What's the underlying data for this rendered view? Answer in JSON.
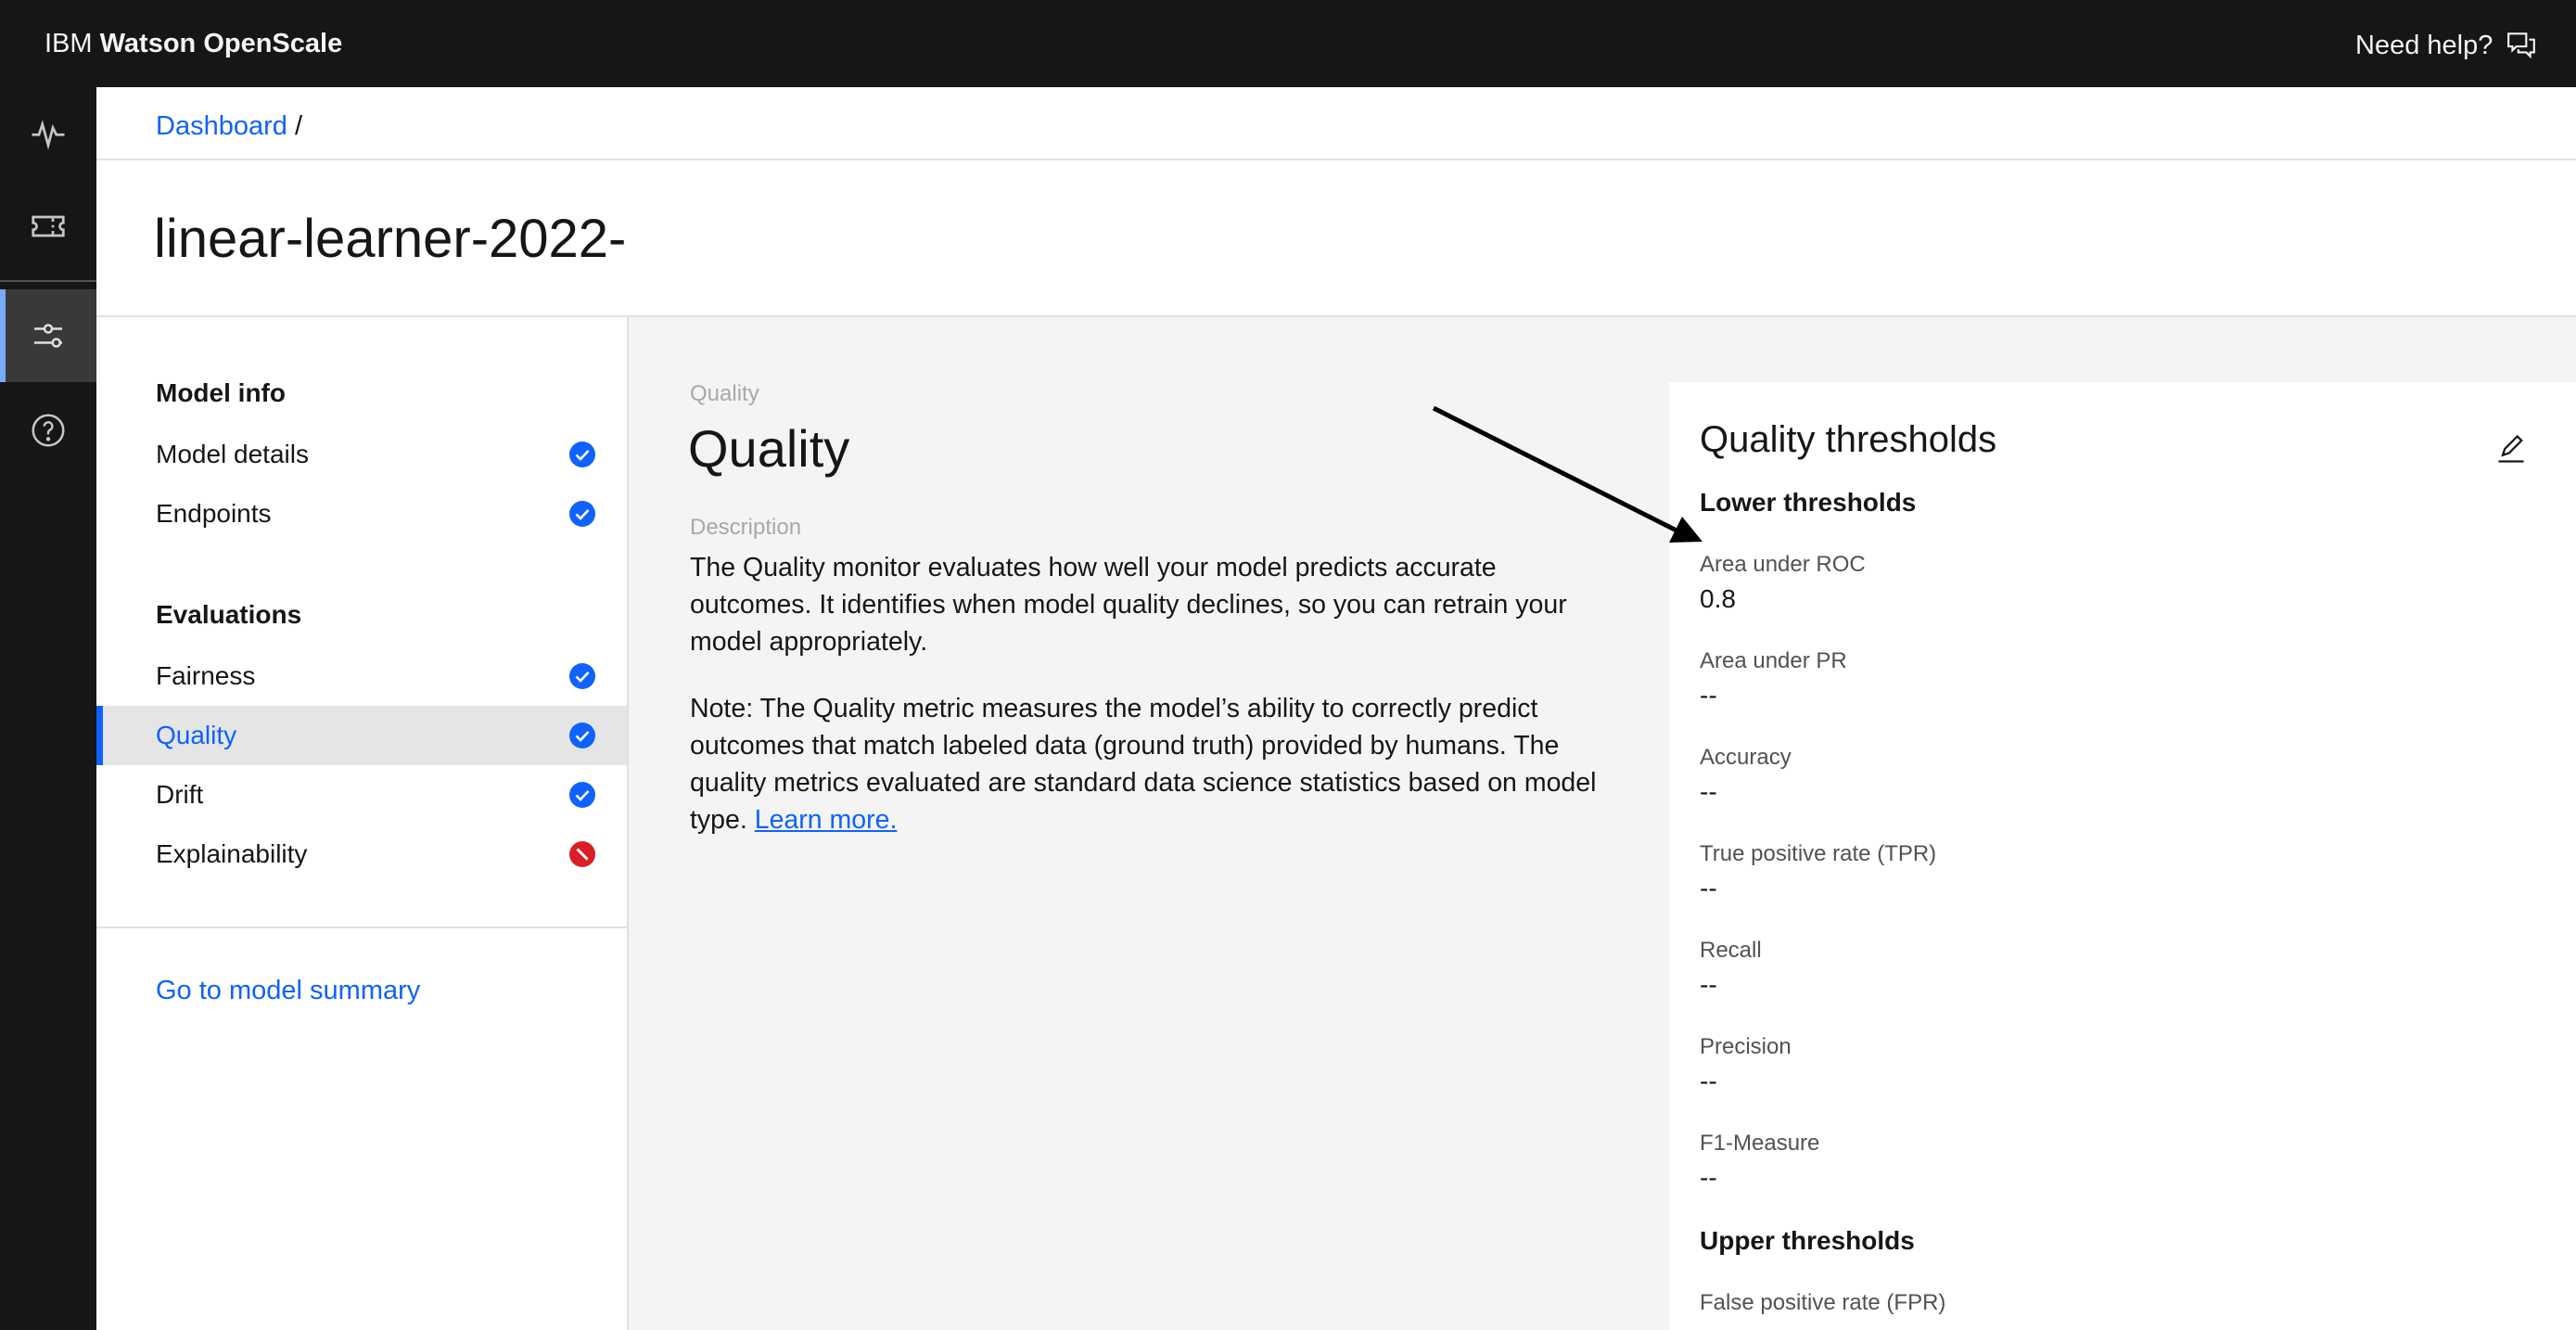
{
  "header": {
    "brand_prefix": "IBM",
    "brand_name": "Watson OpenScale",
    "help_label": "Need help?"
  },
  "breadcrumb": {
    "root": "Dashboard",
    "separator": "/"
  },
  "page_title": "linear-learner-2022-",
  "sidenav": {
    "model_info_heading": "Model info",
    "model_details": "Model details",
    "endpoints": "Endpoints",
    "evaluations_heading": "Evaluations",
    "fairness": "Fairness",
    "quality": "Quality",
    "drift": "Drift",
    "explainability": "Explainability",
    "summary_link": "Go to model summary",
    "status_colors": {
      "ok": "#0f62fe",
      "error": "#da1e28"
    }
  },
  "content": {
    "crumb": "Quality",
    "title": "Quality",
    "desc_label": "Description",
    "description": "The Quality monitor evaluates how well your model predicts accurate outcomes. It identifies when model quality declines, so you can retrain your model appropriately.",
    "note": "Note: The Quality metric measures the model’s ability to correctly predict outcomes that match labeled data (ground truth) provided by humans. The quality metrics evaluated are standard data science statistics based on model type.",
    "learn_more": "Learn more."
  },
  "thresholds": {
    "title": "Quality thresholds",
    "lower_heading": "Lower thresholds",
    "upper_heading": "Upper thresholds",
    "lower": [
      {
        "label": "Area under ROC",
        "value": "0.8"
      },
      {
        "label": "Area under PR",
        "value": "--"
      },
      {
        "label": "Accuracy",
        "value": "--"
      },
      {
        "label": "True positive rate (TPR)",
        "value": "--"
      },
      {
        "label": "Recall",
        "value": "--"
      },
      {
        "label": "Precision",
        "value": "--"
      },
      {
        "label": "F1-Measure",
        "value": "--"
      }
    ],
    "upper": [
      {
        "label": "False positive rate (FPR)"
      }
    ]
  }
}
